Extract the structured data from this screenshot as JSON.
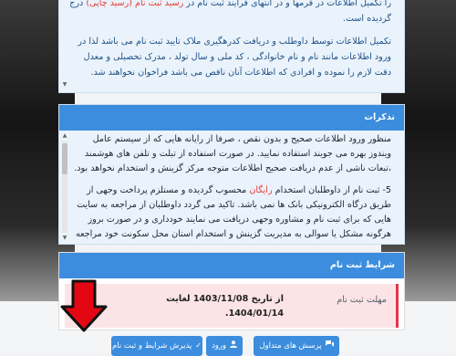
{
  "card1": {
    "line_partial": "را تکمیل اطلاعات در فرمها و در انتهای فرایند ثبت نام در رسید ثبت نام (رسید چاپی) درج",
    "line_partial_red": "رسید ثبت نام (رسید چاپی)",
    "line_end": "گردیده است.",
    "paragraph": "تکمیل اطلاعات توسط داوطلب و دریافت کدرهگیری ملاک تایید ثبت نام می باشد لذا در ورود اطلاعات مانند نام و نام خانوادگی ، کد ملی و سال تولد ، مدرک تحصیلی و معدل دقت لازم را نموده و افرادی که اطلاعات آنان ناقص می باشد فراخوان نخواهند شد."
  },
  "card2": {
    "title": "تذکرات",
    "p1": "منظور ورود اطلاعات صحیح و بدون نقص ، صرفا از رایانه هایی که از سیستم عامل ویندوز بهره می جویند استفاده نمایید. در صورت استفاده از تبلت و تلفن های هوشمند ،تبعات ناشی از عدم دریافت صحیح اطلاعات متوجه مرکز گزینش و استخدام نخواهد بود.",
    "p2_before": "5- ثبت نام از داوطلبان استخدام",
    "p2_red": "رایگان",
    "p2_after": "محسوب گردیده و مستلزم پرداخت وجهی از طریق درگاه الکترونیکی بانک ها نمی باشد. تاکید می گردد داوطلبان از مراجعه به سایت هایی که برای ثبت نام و مشاوره وجهی دریافت می نمایند خودداری و در صورت بروز هرگونه مشکل یا سوالی به مدیریت گزینش و استخدام استان محل سکونت خود مراجعه نمایند."
  },
  "card3": {
    "title": "شرایط ثبت نام",
    "label": "مهلت ثبت نام",
    "value": "از تاریخ 1403/11/08 لغایت 1404/01/14."
  },
  "buttons": {
    "faq": "پرسش های متداول",
    "login": "ورود",
    "accept": "پذیرش شرایط و ثبت نام"
  },
  "colors": {
    "primary": "#3c8dde",
    "alert": "#e0364a",
    "pointer_arrow": "#e30613"
  }
}
